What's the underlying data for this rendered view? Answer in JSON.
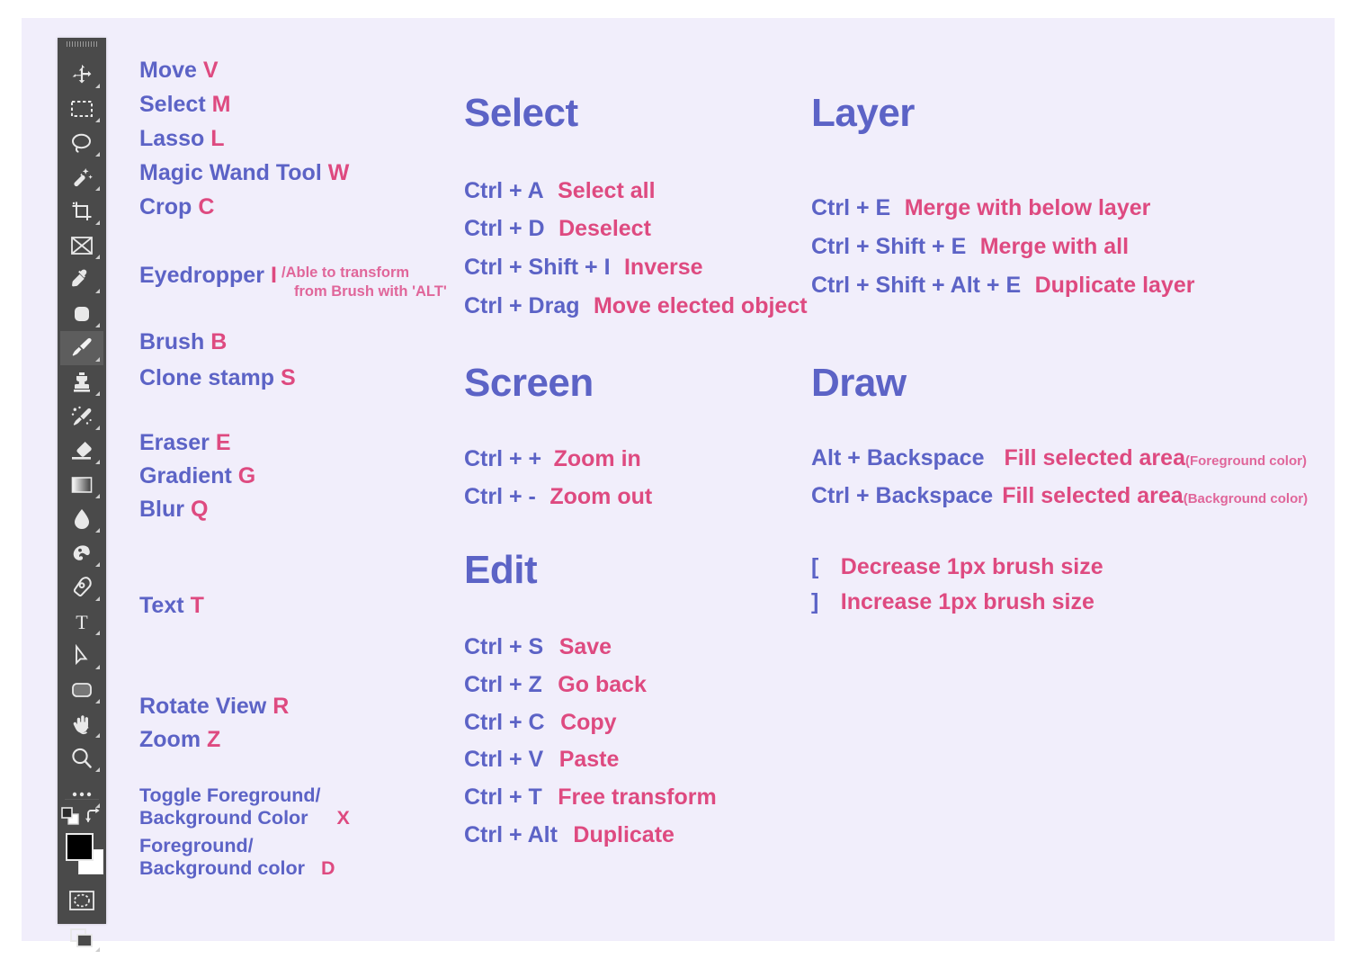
{
  "theme": {
    "panel_bg": "#f1eefb",
    "page_bg": "#ffffff",
    "toolbar_bg": "#4a4a4a",
    "accent_purple": "#5c63c6",
    "accent_pink": "#de4a80",
    "note_pink": "#e0669a"
  },
  "toolbar": {
    "tools": [
      {
        "icon": "move-icon",
        "label": "Move"
      },
      {
        "icon": "rectangular-marquee-icon",
        "label": "Select"
      },
      {
        "icon": "lasso-icon",
        "label": "Lasso"
      },
      {
        "icon": "magic-wand-icon",
        "label": "Magic Wand Tool"
      },
      {
        "icon": "crop-icon",
        "label": "Crop"
      },
      {
        "icon": "frame-icon",
        "label": "Frame"
      },
      {
        "icon": "eyedropper-icon",
        "label": "Eyedropper"
      },
      {
        "icon": "spot-healing-icon",
        "label": "Spot Healing Brush"
      },
      {
        "icon": "brush-icon",
        "label": "Brush",
        "selected": true
      },
      {
        "icon": "clone-stamp-icon",
        "label": "Clone Stamp"
      },
      {
        "icon": "history-brush-icon",
        "label": "History Brush"
      },
      {
        "icon": "eraser-icon",
        "label": "Eraser"
      },
      {
        "icon": "gradient-icon",
        "label": "Gradient"
      },
      {
        "icon": "blur-drop-icon",
        "label": "Blur"
      },
      {
        "icon": "dodge-icon",
        "label": "Dodge"
      },
      {
        "icon": "pen-icon",
        "label": "Pen"
      },
      {
        "icon": "type-icon",
        "label": "Type"
      },
      {
        "icon": "path-selection-icon",
        "label": "Path Selection"
      },
      {
        "icon": "rounded-rectangle-icon",
        "label": "Shape"
      },
      {
        "icon": "hand-rotate-icon",
        "label": "Rotate View"
      },
      {
        "icon": "zoom-magnifier-icon",
        "label": "Zoom"
      },
      {
        "icon": "more-tools-icon",
        "label": "Edit Toolbar"
      },
      {
        "icon": "default-colors-icon",
        "label": "Default Foreground and Background Colors"
      },
      {
        "icon": "swap-colors-icon",
        "label": "Switch Foreground and Background Colors"
      },
      {
        "icon": "color-swatches",
        "label": "Foreground / Background Color"
      },
      {
        "icon": "quick-mask-icon",
        "label": "Quick Mask Mode"
      },
      {
        "icon": "screen-mode-icon",
        "label": "Change Screen Mode"
      }
    ]
  },
  "tools_column": {
    "groups": [
      {
        "items": [
          {
            "name": "Move",
            "key": "V"
          },
          {
            "name": "Select",
            "key": "M"
          },
          {
            "name": "Lasso",
            "key": "L"
          },
          {
            "name": "Magic Wand Tool",
            "key": "W"
          },
          {
            "name": "Crop",
            "key": "C"
          }
        ]
      },
      {
        "items": [
          {
            "name": "Eyedropper",
            "key": "I",
            "note_line1": "/Able to transform",
            "note_line2": "from Brush with 'ALT'"
          },
          {
            "name": "Brush",
            "key": "B"
          },
          {
            "name": "Clone stamp",
            "key": "S"
          }
        ]
      },
      {
        "items": [
          {
            "name": "Eraser",
            "key": "E"
          },
          {
            "name": "Gradient",
            "key": "G"
          },
          {
            "name": "Blur",
            "key": "Q"
          }
        ]
      },
      {
        "items": [
          {
            "name": "Text",
            "key": "T"
          }
        ]
      },
      {
        "items": [
          {
            "name": "Rotate View",
            "key": "R"
          },
          {
            "name": "Zoom",
            "key": "Z"
          }
        ]
      },
      {
        "items": [
          {
            "name_line1": "Toggle Foreground/",
            "name_line2": "Background Color",
            "key": "X"
          },
          {
            "name_line1": "Foreground/",
            "name_line2": "Background color",
            "key": "D"
          }
        ]
      }
    ]
  },
  "sections": {
    "select": {
      "title": "Select",
      "rows": [
        {
          "combo": "Ctrl + A",
          "action": "Select all"
        },
        {
          "combo": "Ctrl + D",
          "action": "Deselect"
        },
        {
          "combo": "Ctrl + Shift + I",
          "action": "Inverse"
        },
        {
          "combo": "Ctrl + Drag",
          "action": "Move elected object"
        }
      ]
    },
    "screen": {
      "title": "Screen",
      "rows": [
        {
          "combo": "Ctrl + +",
          "action": "Zoom in"
        },
        {
          "combo": "Ctrl + -",
          "action": "Zoom out"
        }
      ]
    },
    "edit": {
      "title": "Edit",
      "rows": [
        {
          "combo": "Ctrl + S",
          "action": "Save"
        },
        {
          "combo": "Ctrl + Z",
          "action": "Go back"
        },
        {
          "combo": "Ctrl + C",
          "action": "Copy"
        },
        {
          "combo": "Ctrl + V",
          "action": "Paste"
        },
        {
          "combo": "Ctrl + T",
          "action": "Free transform"
        },
        {
          "combo": "Ctrl + Alt",
          "action": "Duplicate"
        }
      ]
    },
    "layer": {
      "title": "Layer",
      "rows": [
        {
          "combo": "Ctrl + E",
          "action": "Merge with below layer"
        },
        {
          "combo": "Ctrl + Shift + E",
          "action": "Merge with all"
        },
        {
          "combo": "Ctrl + Shift + Alt + E",
          "action": "Duplicate layer"
        }
      ]
    },
    "draw": {
      "title": "Draw",
      "rows": [
        {
          "combo": "Alt + Backspace",
          "action": "Fill selected area",
          "sub": "(Foreground color)"
        },
        {
          "combo": "Ctrl + Backspace",
          "action": "Fill selected area",
          "sub": "(Background color)"
        }
      ],
      "brush_rows": [
        {
          "combo": "[",
          "action": "Decrease 1px brush size"
        },
        {
          "combo": "]",
          "action": "Increase 1px brush size"
        }
      ]
    }
  }
}
